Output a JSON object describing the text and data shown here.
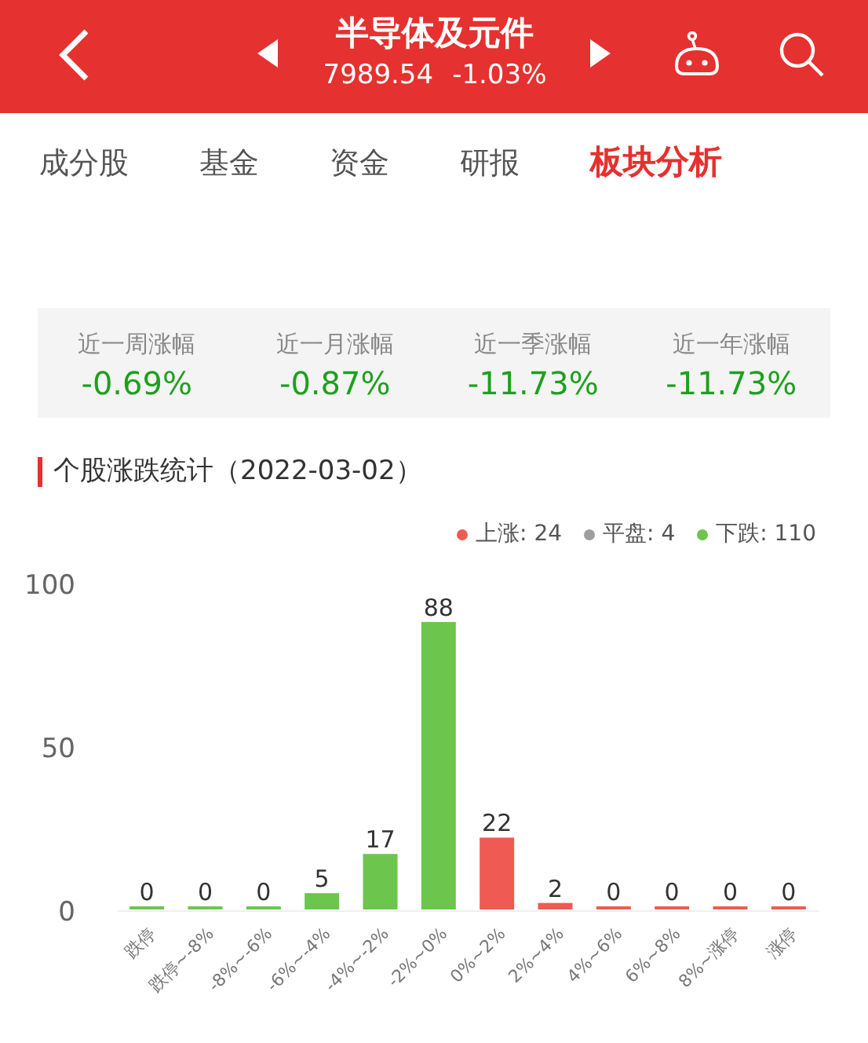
{
  "header": {
    "title": "半导体及元件",
    "price": "7989.54",
    "change": "-1.03%"
  },
  "tabs": [
    {
      "label": "成分股",
      "selected": false
    },
    {
      "label": "基金",
      "selected": false
    },
    {
      "label": "资金",
      "selected": false
    },
    {
      "label": "研报",
      "selected": false
    },
    {
      "label": "板块分析",
      "selected": true
    }
  ],
  "stats": [
    {
      "label": "近一周涨幅",
      "value": "-0.69%"
    },
    {
      "label": "近一月涨幅",
      "value": "-0.87%"
    },
    {
      "label": "近一季涨幅",
      "value": "-11.73%"
    },
    {
      "label": "近一年涨幅",
      "value": "-11.73%"
    }
  ],
  "section_title": "个股涨跌统计（2022-03-02）",
  "legend": [
    {
      "label": "上涨: 24",
      "color": "#ef5b52"
    },
    {
      "label": "平盘: 4",
      "color": "#9e9e9e"
    },
    {
      "label": "下跌: 110",
      "color": "#6cc64e"
    }
  ],
  "chart_data": {
    "type": "bar",
    "categories": [
      "跌停",
      "跌停~-8%",
      "-8%~-6%",
      "-6%~-4%",
      "-4%~-2%",
      "-2%~0%",
      "0%~2%",
      "2%~4%",
      "4%~6%",
      "6%~8%",
      "8%~涨停",
      "涨停"
    ],
    "series": [
      {
        "color": "#6cc64e",
        "values": [
          0,
          0,
          0,
          5,
          17,
          88,
          null,
          null,
          null,
          null,
          null,
          null
        ]
      },
      {
        "color": "#ef5b52",
        "values": [
          null,
          null,
          null,
          null,
          null,
          null,
          22,
          2,
          0,
          0,
          0,
          0
        ]
      }
    ],
    "ylim": [
      0,
      100
    ],
    "yticks": [
      0,
      50,
      100
    ],
    "data_labels": true
  }
}
